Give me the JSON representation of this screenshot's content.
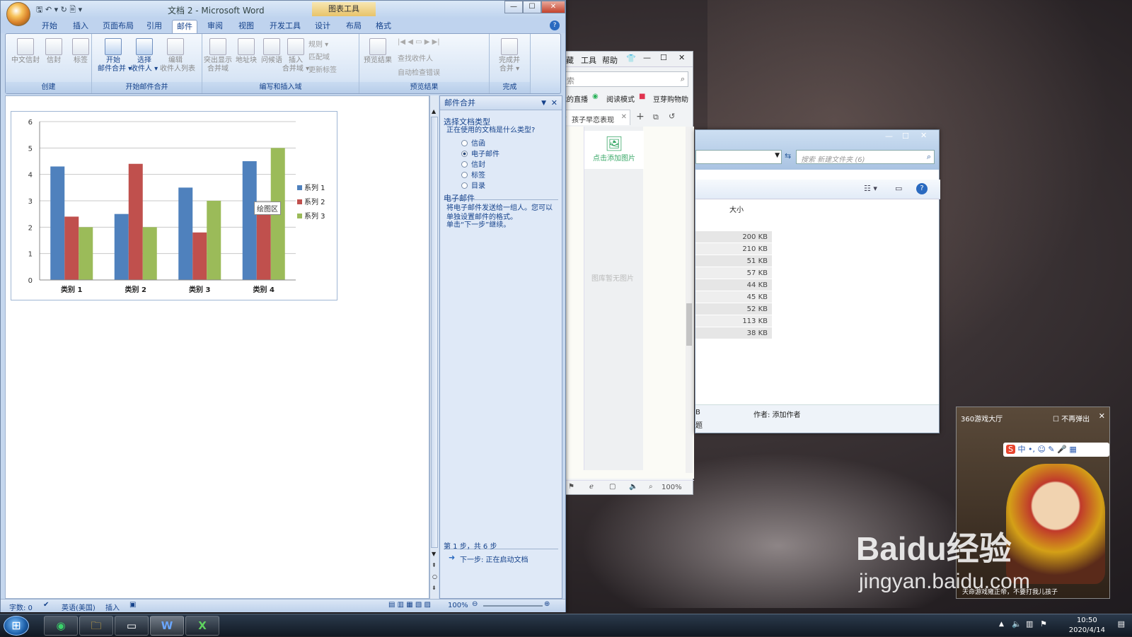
{
  "word": {
    "qat": "🖫 ↶ ▾ ↻ 🖹 ▾",
    "title": "文档 2 - Microsoft Word",
    "chart_tools": "图表工具",
    "tabs": [
      "开始",
      "插入",
      "页面布局",
      "引用",
      "邮件",
      "审阅",
      "视图",
      "开发工具",
      "设计",
      "布局",
      "格式"
    ],
    "active_tab": "邮件",
    "ribbon": {
      "groups": [
        {
          "label": "创建",
          "buttons": [
            "中文信封",
            "信封",
            "标签"
          ]
        },
        {
          "label": "开始邮件合并",
          "buttons": [
            "开始\n邮件合并 ▾",
            "选择\n收件人 ▾",
            "编辑\n收件人列表"
          ]
        },
        {
          "label": "编写和插入域",
          "buttons": [
            "突出显示\n合并域",
            "地址块",
            "问候语",
            "插入\n合并域 ▾"
          ],
          "small": [
            "规则 ▾",
            "匹配域",
            "更新标签"
          ]
        },
        {
          "label": "预览结果",
          "buttons": [
            "预览结果"
          ],
          "small": [
            "查找收件人",
            "自动检查错误"
          ]
        },
        {
          "label": "完成",
          "buttons": [
            "完成并\n合并 ▾"
          ]
        }
      ]
    },
    "tooltip": "绘图区",
    "task_pane": {
      "title": "邮件合并",
      "section1_title": "选择文档类型",
      "question": "正在使用的文档是什么类型?",
      "options": [
        "信函",
        "电子邮件",
        "信封",
        "标签",
        "目录"
      ],
      "selected_option": "电子邮件",
      "section2_title": "电子邮件",
      "description": "将电子邮件发送给一组人。您可以单独设置邮件的格式。",
      "instruction": "单击“下一步”继续。",
      "step": "第 1 步，共 6 步",
      "next_link": "下一步: 正在启动文档"
    },
    "status": {
      "word_count": "字数: 0",
      "language": "英语(美国)",
      "mode": "插入",
      "zoom": "100%"
    }
  },
  "chart_data": {
    "type": "bar",
    "categories": [
      "类别 1",
      "类别 2",
      "类别 3",
      "类别 4"
    ],
    "series": [
      {
        "name": "系列 1",
        "values": [
          4.3,
          2.5,
          3.5,
          4.5
        ],
        "color": "#4f81bd"
      },
      {
        "name": "系列 2",
        "values": [
          2.4,
          4.4,
          1.8,
          2.8
        ],
        "color": "#c0504d"
      },
      {
        "name": "系列 3",
        "values": [
          2.0,
          2.0,
          3.0,
          5.0
        ],
        "color": "#9bbb59"
      }
    ],
    "yticks": [
      "0",
      "1",
      "2",
      "3",
      "4",
      "5",
      "6"
    ],
    "ylim": [
      0,
      6
    ],
    "grid": true,
    "legend": "right"
  },
  "browser": {
    "menu": [
      "收藏",
      "工具",
      "帮助"
    ],
    "search_placeholder": "搜索",
    "toolbar": [
      "我的直播",
      "阅读模式",
      "豆芽购物助"
    ],
    "tab_title": "孩子早恋表现",
    "add_image": "点击添加图片",
    "empty_text": "图库暂无图片",
    "zoom": "100%"
  },
  "explorer": {
    "search_placeholder": "搜索 新建文件夹 (6)",
    "column_size": "大小",
    "sizes": [
      "200 KB",
      "210 KB",
      "51 KB",
      "57 KB",
      "44 KB",
      "45 KB",
      "52 KB",
      "113 KB",
      "38 KB"
    ],
    "details_left": "B",
    "details_left2": "题",
    "author": "作者: 添加作者"
  },
  "popup": {
    "title": "360游戏大厅",
    "no_popup": "不再弹出",
    "caption": "天命游戏雍正帝，不要打我儿孩子"
  },
  "watermark": {
    "logo": "Baidu经验",
    "url": "jingyan.baidu.com"
  },
  "taskbar": {
    "time": "10:50",
    "date": "2020/4/14"
  }
}
